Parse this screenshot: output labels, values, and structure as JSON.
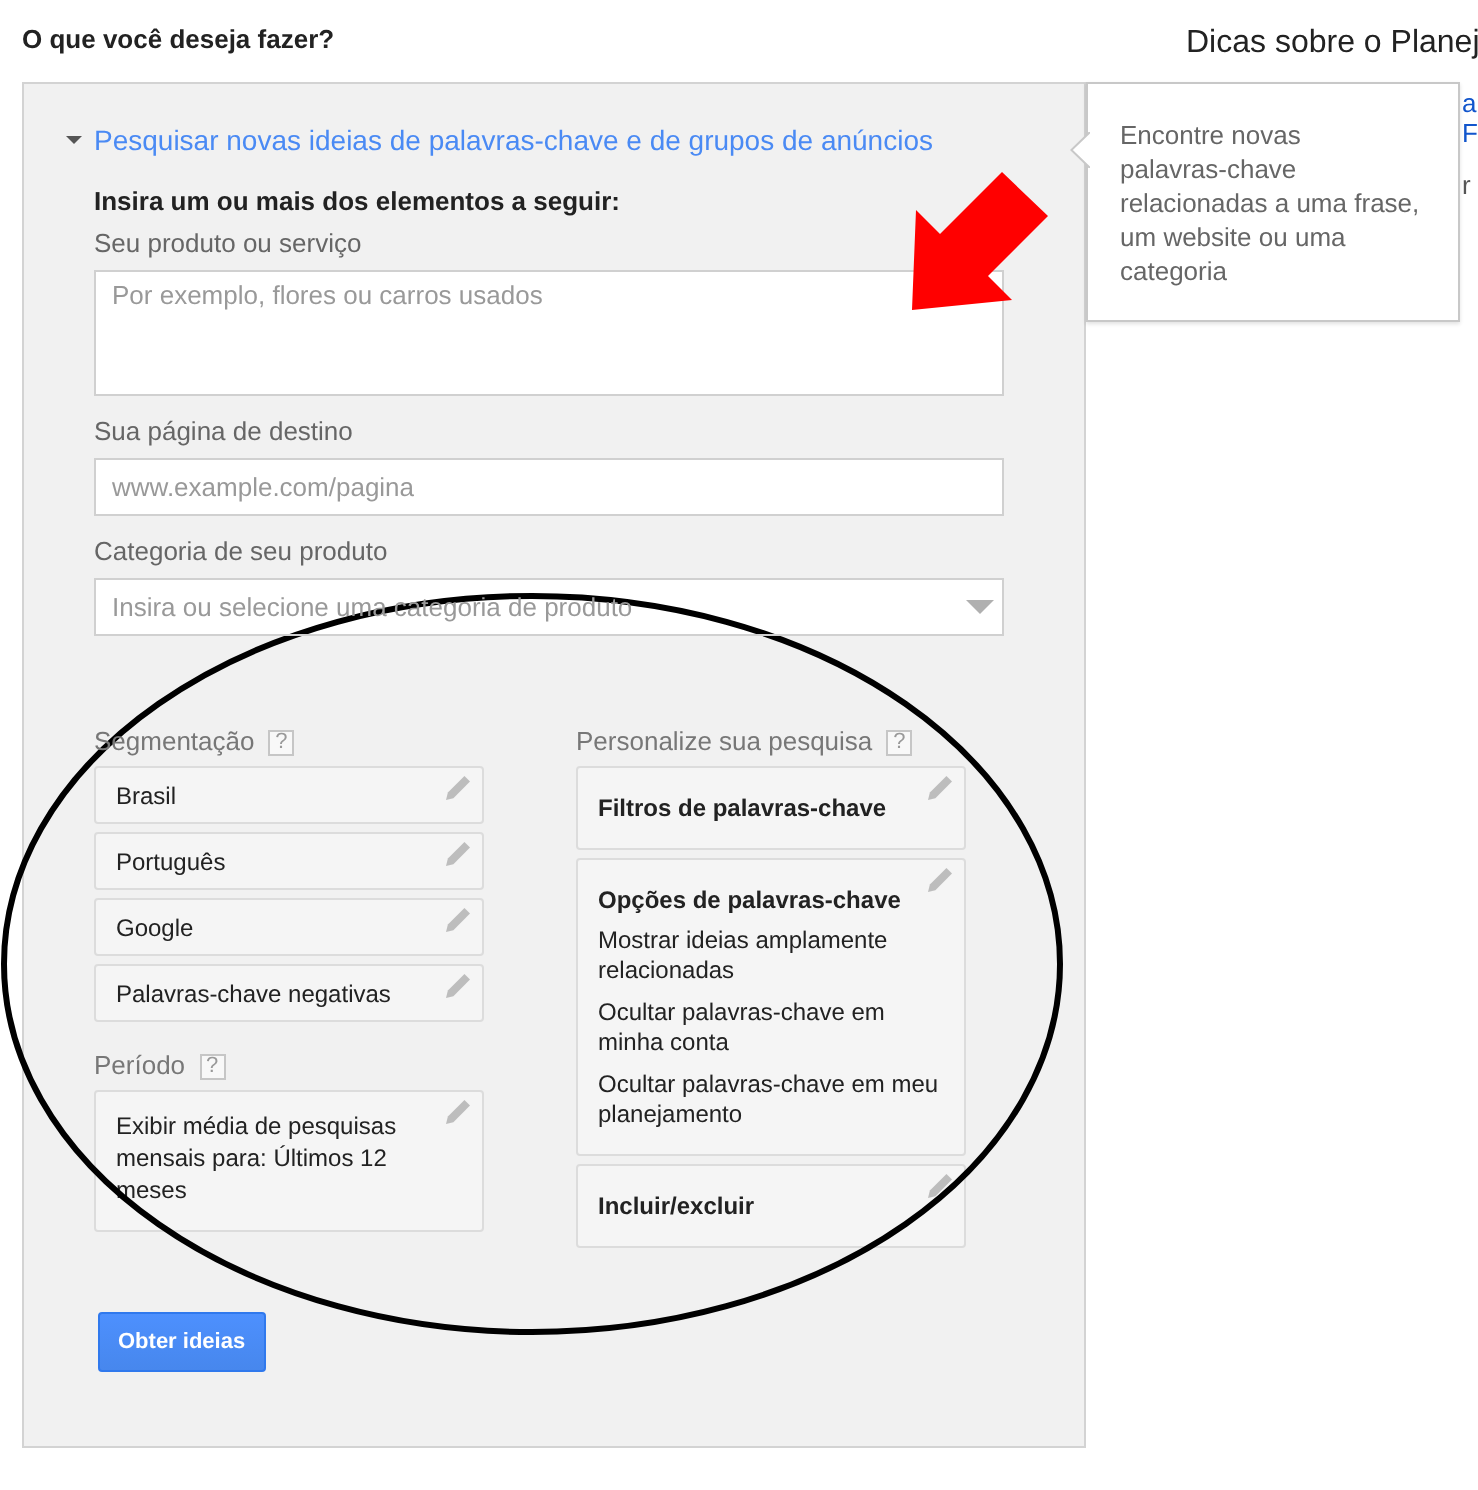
{
  "page_title": "O que você deseja fazer?",
  "tips": {
    "title": "Dicas sobre o Planej",
    "lines": [
      {
        "parts": [
          {
            "text": "a",
            "kind": "link"
          }
        ]
      },
      {
        "parts": [
          {
            "text": "F",
            "kind": "link"
          }
        ]
      },
      {
        "parts": [
          {
            "text": "r",
            "kind": "text"
          }
        ]
      }
    ]
  },
  "tooltip": {
    "text": "Encontre novas palavras-chave relacionadas a uma frase, um website ou uma categoria"
  },
  "section": {
    "title": "Pesquisar novas ideias de palavras-chave e de grupos de anúncios",
    "expanded": true,
    "instruction": "Insira um ou mais dos elementos a seguir:",
    "fields": [
      {
        "kind": "textarea",
        "label": "Seu produto ou serviço",
        "placeholder": "Por exemplo, flores ou carros usados"
      },
      {
        "kind": "input",
        "label": "Sua página de destino",
        "placeholder": "www.example.com/pagina"
      },
      {
        "kind": "dropdown",
        "label": "Categoria de seu produto",
        "placeholder": "Insira ou selecione uma categoria de produto"
      }
    ],
    "targeting": {
      "label": "Segmentação",
      "help": "?",
      "items": [
        "Brasil",
        "Português",
        "Google",
        "Palavras-chave negativas"
      ]
    },
    "period": {
      "label": "Período",
      "help": "?",
      "text": "Exibir média de pesquisas mensais para: Últimos 12 meses"
    },
    "customize": {
      "label": "Personalize sua pesquisa",
      "help": "?",
      "items": [
        {
          "title": "Filtros de palavras-chave"
        },
        {
          "title": "Opções de palavras-chave",
          "lines": [
            "Mostrar ideias amplamente relacionadas",
            "Ocultar palavras-chave em minha conta",
            "Ocultar palavras-chave em meu planejamento"
          ]
        },
        {
          "title": "Incluir/excluir"
        }
      ]
    },
    "submit": "Obter ideias"
  }
}
